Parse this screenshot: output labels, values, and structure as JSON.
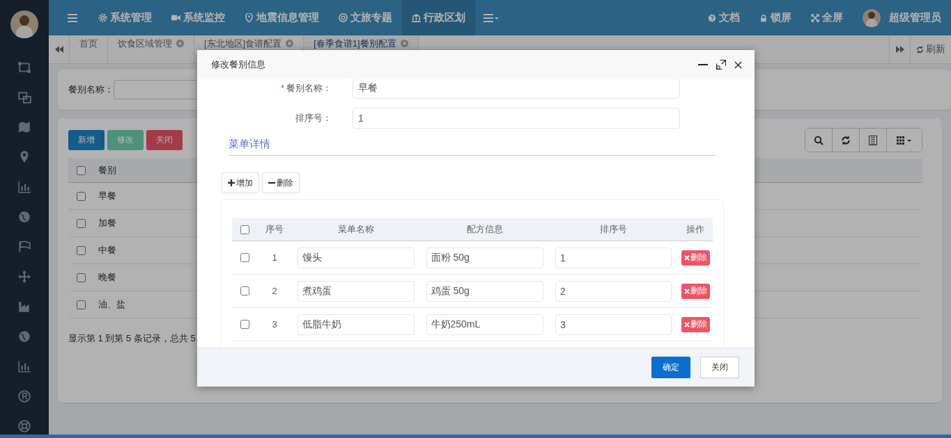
{
  "top_nav": {
    "menu": [
      {
        "label": "系统管理",
        "selected": false
      },
      {
        "label": "系统监控",
        "selected": false
      },
      {
        "label": "地震信息管理",
        "selected": false
      },
      {
        "label": "文旅专题",
        "selected": false
      },
      {
        "label": "行政区划",
        "selected": true
      }
    ],
    "right": [
      "文档",
      "锁屏",
      "全屏"
    ],
    "user": "超级管理员"
  },
  "tabs": [
    {
      "label": "首页",
      "selected": false,
      "closable": false
    },
    {
      "label": "饮食区域管理",
      "selected": false,
      "closable": true
    },
    {
      "label": "[东北地区]食谱配置",
      "selected": false,
      "closable": true
    },
    {
      "label": "[春季食谱1]餐别配置",
      "selected": true,
      "closable": true
    }
  ],
  "refresh": "刷新",
  "search": {
    "label": "餐别名称："
  },
  "toolbar": [
    "新增",
    "修改",
    "关闭"
  ],
  "table": {
    "columns": [
      "餐别"
    ],
    "all_checked": false,
    "rows": [
      {
        "name": "早餐",
        "checked": false
      },
      {
        "name": "加餐",
        "checked": false
      },
      {
        "name": "中餐",
        "checked": false
      },
      {
        "name": "晚餐",
        "checked": false
      },
      {
        "name": "油、盐",
        "checked": false
      }
    ]
  },
  "pagination": "显示第 1 到第 5 条记录，总共 5",
  "dialog": {
    "title": "修改餐别信息",
    "fields": [
      {
        "label": "餐别名称：",
        "required_mark": "*",
        "value": "早餐"
      },
      {
        "label": "排序号：",
        "value": "1"
      }
    ],
    "all_checked": false,
    "section": "菜单详情",
    "actions": [
      "增加",
      "删除"
    ],
    "columns": [
      "序号",
      "菜单名称",
      "配方信息",
      "排序号",
      "操作"
    ],
    "rows": [
      {
        "index": "1",
        "name": "馒头",
        "recipe": "面粉 50g",
        "order": "1",
        "delete": "删除",
        "checked": false
      },
      {
        "index": "2",
        "name": "煮鸡蛋",
        "recipe": "鸡蛋 50g",
        "order": "2",
        "delete": "删除",
        "checked": false
      },
      {
        "index": "3",
        "name": "低脂牛奶",
        "recipe": "牛奶250mL",
        "order": "3",
        "delete": "删除",
        "checked": false
      }
    ],
    "buttons": [
      "确定",
      "关闭"
    ]
  }
}
